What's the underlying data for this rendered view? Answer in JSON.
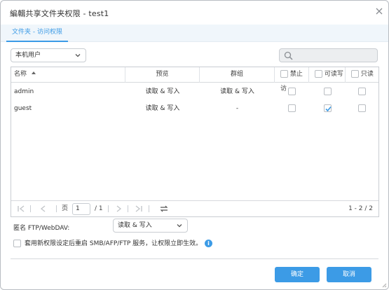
{
  "dialog": {
    "title": "編輯共享文件夹权限 - test1",
    "close_icon": "close-icon"
  },
  "tabs": [
    {
      "label": "文件夹 - 访问权限",
      "active": true
    }
  ],
  "toolbar": {
    "user_type_select": "本机用户",
    "search_placeholder": ""
  },
  "table": {
    "columns": {
      "name": "名称",
      "preview": "预览",
      "group": "群组",
      "deny": "禁止访",
      "read_write": "可读写",
      "read_only": "只读"
    },
    "rows": [
      {
        "name": "admin",
        "preview": "读取 & 写入",
        "group": "读取 & 写入",
        "deny": false,
        "read_write": false,
        "read_only": false
      },
      {
        "name": "guest",
        "preview": "读取 & 写入",
        "group": "-",
        "deny": false,
        "read_write": true,
        "read_only": false
      }
    ]
  },
  "pager": {
    "page_label": "页",
    "current_page": "1",
    "total_pages": "/ 1",
    "range": "1 - 2 / 2"
  },
  "anon": {
    "label": "匿名 FTP/WebDAV:",
    "value": "读取 & 写入"
  },
  "apply_checkbox": {
    "label": "套用新权限设定后重启 SMB/AFP/FTP 服务，让权限立即生效。",
    "checked": false
  },
  "buttons": {
    "ok": "确定",
    "cancel": "取消"
  },
  "colors": {
    "accent": "#3c9be6",
    "tab_bar_bg": "#f0f6fb",
    "border": "#c9cdd2"
  }
}
